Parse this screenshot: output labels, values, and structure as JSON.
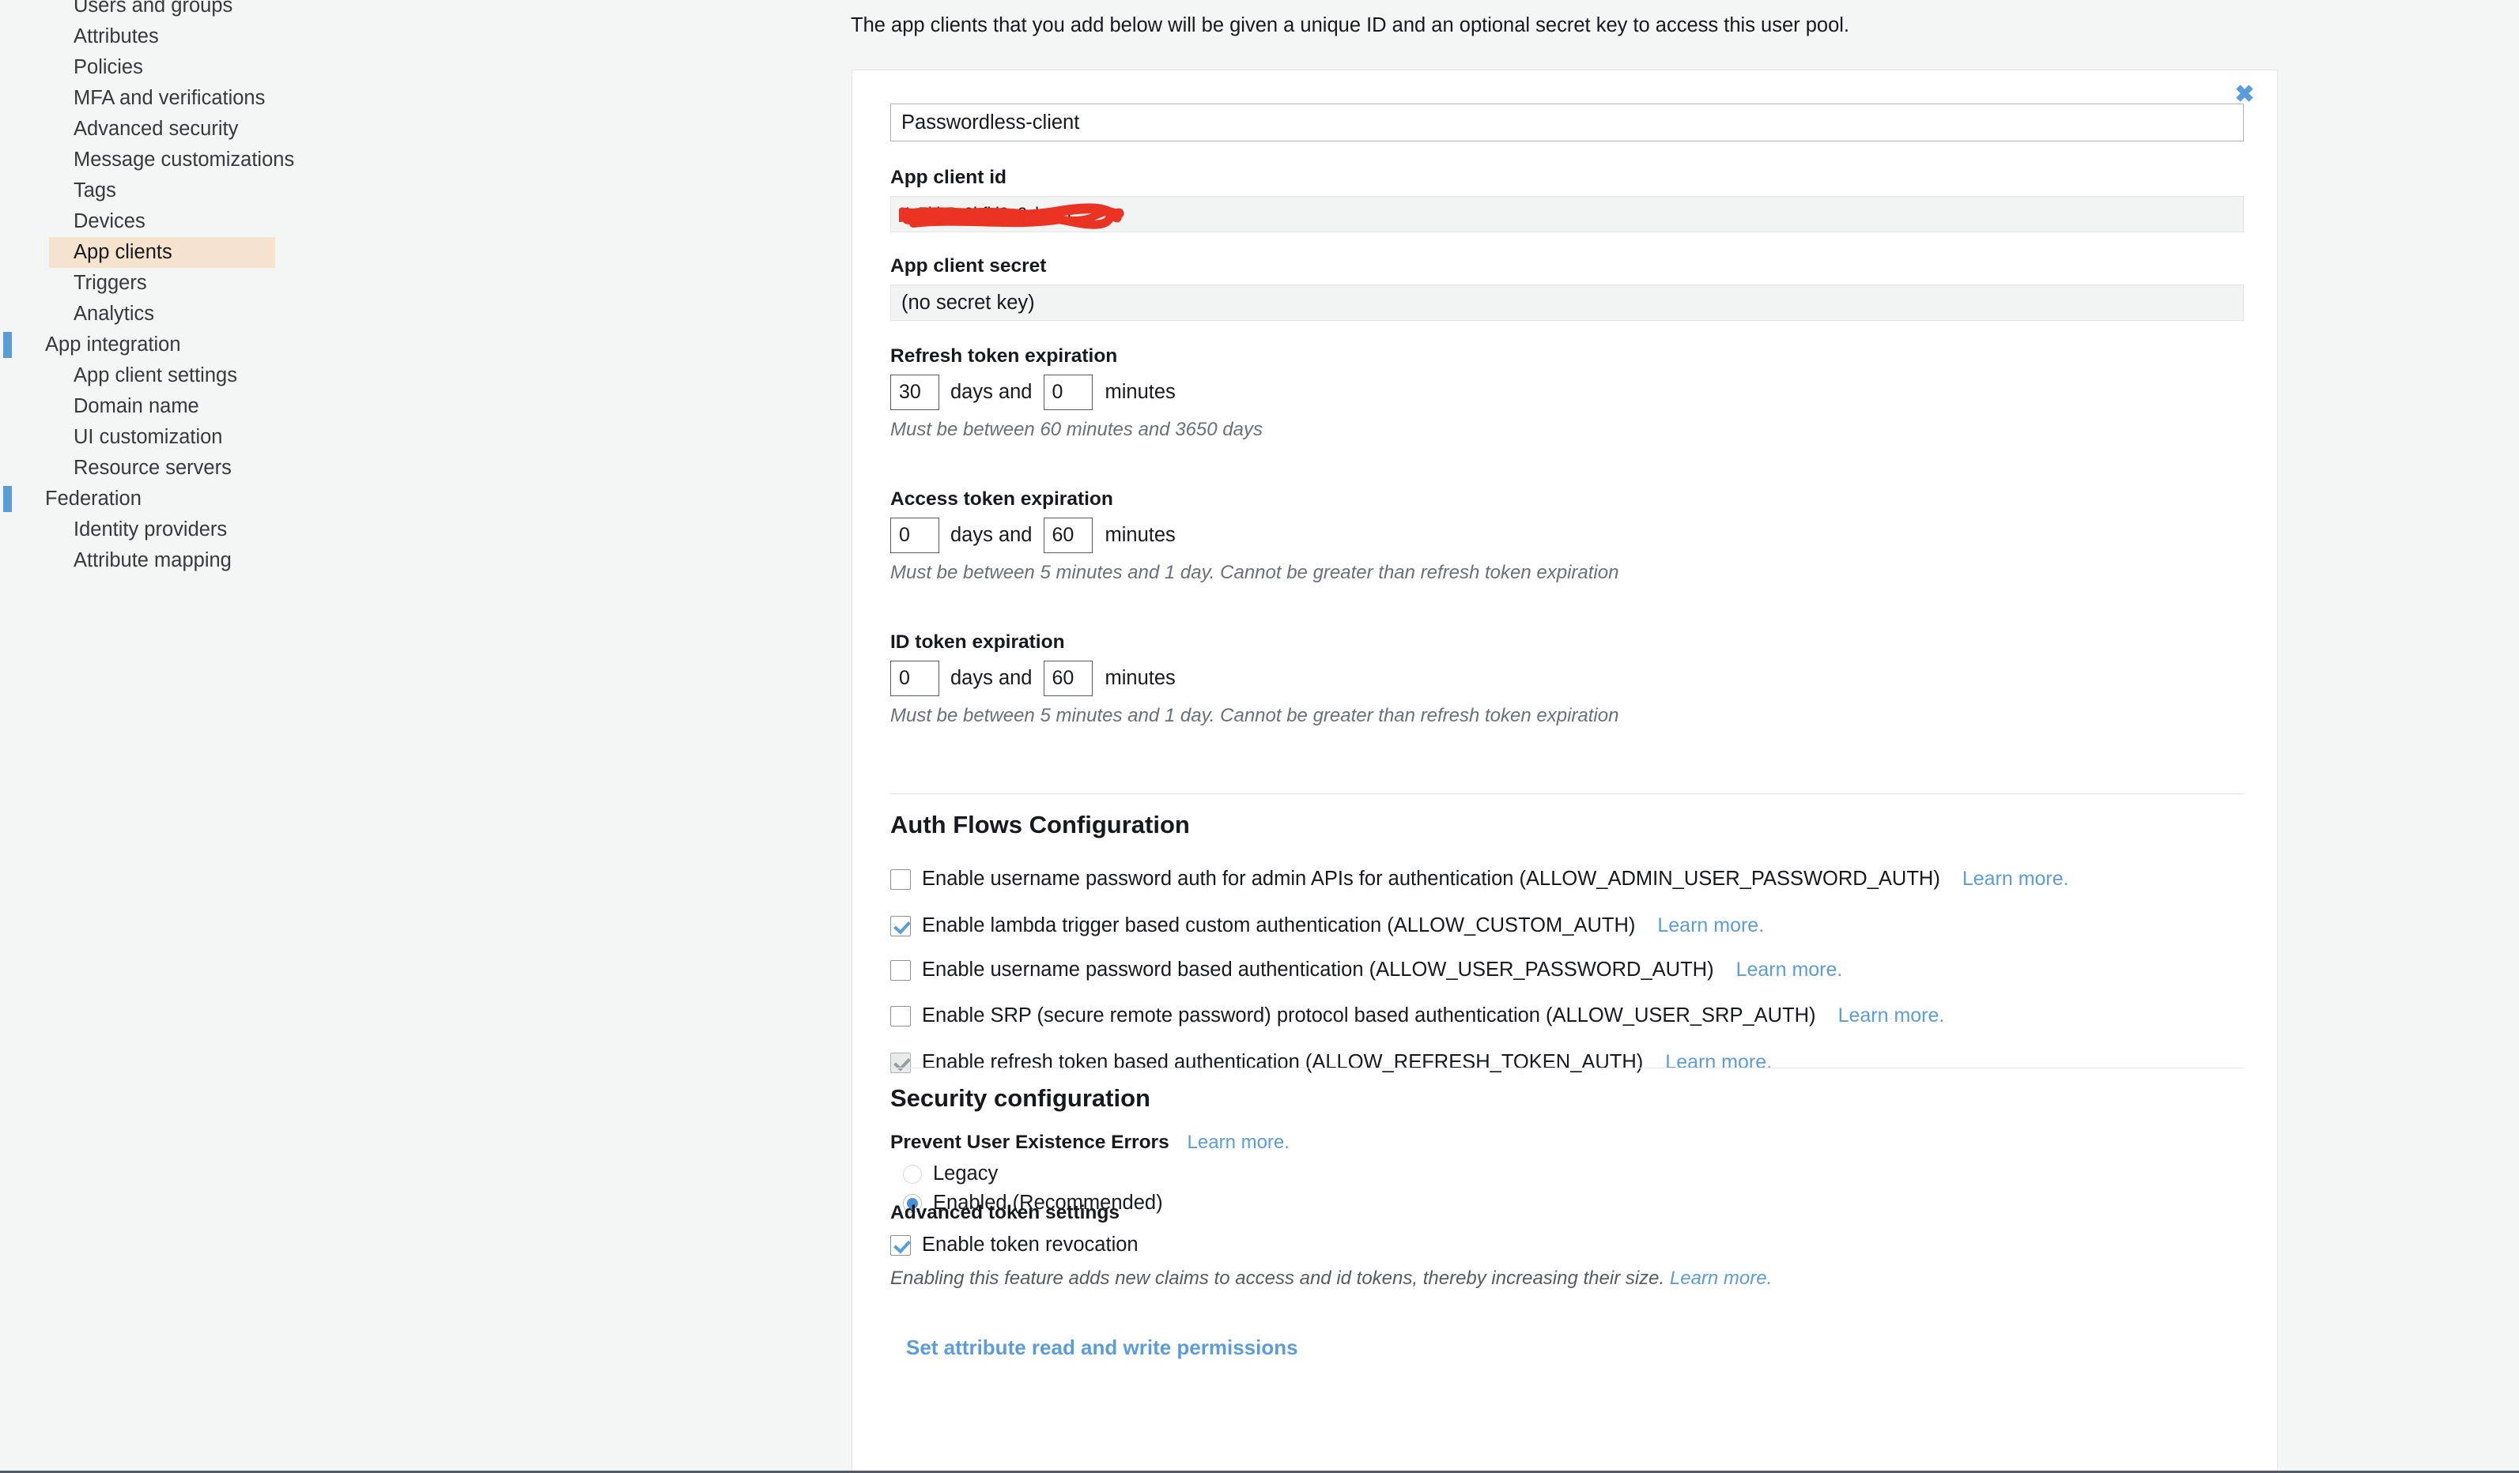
{
  "sidebar": {
    "items": [
      {
        "label": "Users and groups",
        "level": "sub",
        "active": false,
        "marker": false
      },
      {
        "label": "Attributes",
        "level": "sub",
        "active": false,
        "marker": false
      },
      {
        "label": "Policies",
        "level": "sub",
        "active": false,
        "marker": false
      },
      {
        "label": "MFA and verifications",
        "level": "sub",
        "active": false,
        "marker": false
      },
      {
        "label": "Advanced security",
        "level": "sub",
        "active": false,
        "marker": false
      },
      {
        "label": "Message customizations",
        "level": "sub",
        "active": false,
        "marker": false
      },
      {
        "label": "Tags",
        "level": "sub",
        "active": false,
        "marker": false
      },
      {
        "label": "Devices",
        "level": "sub",
        "active": false,
        "marker": false
      },
      {
        "label": "App clients",
        "level": "sub",
        "active": true,
        "marker": false
      },
      {
        "label": "Triggers",
        "level": "sub",
        "active": false,
        "marker": false
      },
      {
        "label": "Analytics",
        "level": "sub",
        "active": false,
        "marker": false
      },
      {
        "label": "App integration",
        "level": "top",
        "active": false,
        "marker": true
      },
      {
        "label": "App client settings",
        "level": "sub",
        "active": false,
        "marker": false
      },
      {
        "label": "Domain name",
        "level": "sub",
        "active": false,
        "marker": false
      },
      {
        "label": "UI customization",
        "level": "sub",
        "active": false,
        "marker": false
      },
      {
        "label": "Resource servers",
        "level": "sub",
        "active": false,
        "marker": false
      },
      {
        "label": "Federation",
        "level": "top",
        "active": false,
        "marker": true
      },
      {
        "label": "Identity providers",
        "level": "sub",
        "active": false,
        "marker": false
      },
      {
        "label": "Attribute mapping",
        "level": "sub",
        "active": false,
        "marker": false
      }
    ]
  },
  "main": {
    "intro": "The app clients that you add below will be given a unique ID and an optional secret key to access this user pool.",
    "close_label": "✖",
    "client_name": {
      "value": "Passwordless-client"
    },
    "app_client_id": {
      "label": "App client id",
      "value": "redacted",
      "redacted": true
    },
    "app_client_secret": {
      "label": "App client secret",
      "value": "(no secret key)"
    },
    "refresh_token": {
      "label": "Refresh token expiration",
      "days": "30",
      "minutes": "0",
      "days_sep": "days and",
      "minutes_sep": "minutes",
      "hint": "Must be between 60 minutes and 3650 days"
    },
    "access_token": {
      "label": "Access token expiration",
      "days": "0",
      "minutes": "60",
      "days_sep": "days and",
      "minutes_sep": "minutes",
      "hint": "Must be between 5 minutes and 1 day. Cannot be greater than refresh token expiration"
    },
    "id_token": {
      "label": "ID token expiration",
      "days": "0",
      "minutes": "60",
      "days_sep": "days and",
      "minutes_sep": "minutes",
      "hint": "Must be between 5 minutes and 1 day. Cannot be greater than refresh token expiration"
    },
    "auth_flows": {
      "title": "Auth Flows Configuration",
      "items": [
        {
          "label": "Enable username password auth for admin APIs for authentication (ALLOW_ADMIN_USER_PASSWORD_AUTH)",
          "checked": false,
          "disabled": false,
          "learn": "Learn more."
        },
        {
          "label": "Enable lambda trigger based custom authentication (ALLOW_CUSTOM_AUTH)",
          "checked": true,
          "disabled": false,
          "learn": "Learn more."
        },
        {
          "label": "Enable username password based authentication (ALLOW_USER_PASSWORD_AUTH)",
          "checked": false,
          "disabled": false,
          "learn": "Learn more."
        },
        {
          "label": "Enable SRP (secure remote password) protocol based authentication (ALLOW_USER_SRP_AUTH)",
          "checked": false,
          "disabled": false,
          "learn": "Learn more."
        },
        {
          "label": "Enable refresh token based authentication (ALLOW_REFRESH_TOKEN_AUTH)",
          "checked": true,
          "disabled": true,
          "learn": "Learn more."
        }
      ]
    },
    "security": {
      "title": "Security configuration",
      "prevent_errors_label": "Prevent User Existence Errors",
      "prevent_errors_learn": "Learn more.",
      "options": [
        {
          "label": "Legacy",
          "selected": false
        },
        {
          "label": "Enabled (Recommended)",
          "selected": true
        }
      ]
    },
    "advanced_tokens": {
      "title": "Advanced token settings",
      "revocation_label": "Enable token revocation",
      "revocation_checked": true,
      "note": "Enabling this feature adds new claims to access and id tokens, thereby increasing their size.",
      "note_learn": "Learn more."
    },
    "set_permissions_link": "Set attribute read and write permissions"
  },
  "colors": {
    "accent_blue": "#5b9dd9",
    "active_nav_bg": "#f6e3ce",
    "page_bg": "#f4f5f5",
    "card_bg": "#ffffff",
    "redaction_red": "#ea3323",
    "marker_blue": "#5b9dd9"
  }
}
